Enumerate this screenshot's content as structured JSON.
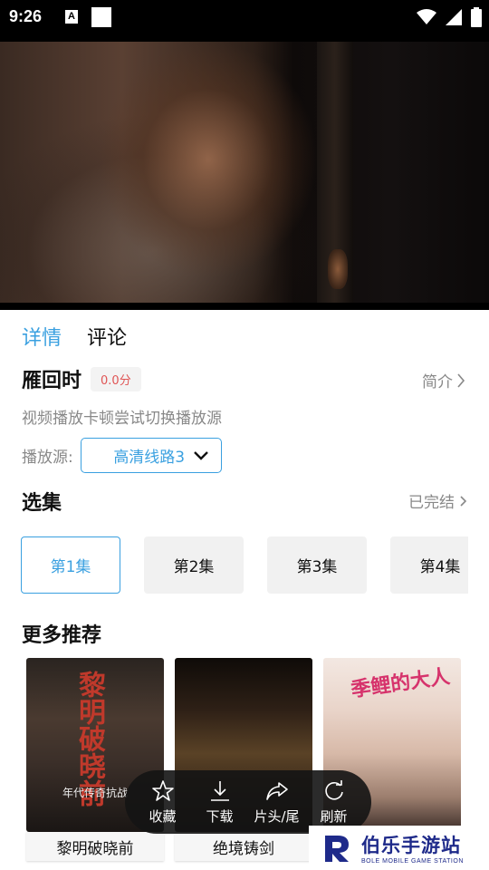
{
  "status_bar": {
    "time": "9:26",
    "notification_letter": "A"
  },
  "tabs": [
    {
      "label": "详情",
      "active": true
    },
    {
      "label": "评论",
      "active": false
    }
  ],
  "show": {
    "title": "雁回时",
    "score": "0.0分",
    "intro_link": "简介",
    "tip": "视频播放卡顿尝试切换播放源"
  },
  "source": {
    "label": "播放源:",
    "selected": "高清线路3"
  },
  "episodes": {
    "header": "选集",
    "status": "已完结",
    "items": [
      {
        "label": "第1集",
        "active": true
      },
      {
        "label": "第2集",
        "active": false
      },
      {
        "label": "第3集",
        "active": false
      },
      {
        "label": "第4集",
        "active": false
      }
    ]
  },
  "recommend": {
    "header": "更多推荐",
    "items": [
      {
        "title": "黎明破晓前",
        "poster_text": "黎明破晓前",
        "poster_tag": "年代传奇抗战"
      },
      {
        "title": "绝境铸剑"
      },
      {
        "title": "",
        "poster_text": "季鲤的大人"
      }
    ]
  },
  "overlay_menu": [
    {
      "label": "收藏",
      "icon": "star-icon"
    },
    {
      "label": "下载",
      "icon": "download-icon"
    },
    {
      "label": "片头/尾",
      "icon": "share-arrow-icon"
    },
    {
      "label": "刷新",
      "icon": "refresh-icon"
    }
  ],
  "watermark": {
    "main": "伯乐手游站",
    "sub": "BOLE MOBILE GAME STATION"
  },
  "colors": {
    "accent": "#3aa0e0",
    "score": "#e05555",
    "watermark": "#1e2a8a"
  }
}
